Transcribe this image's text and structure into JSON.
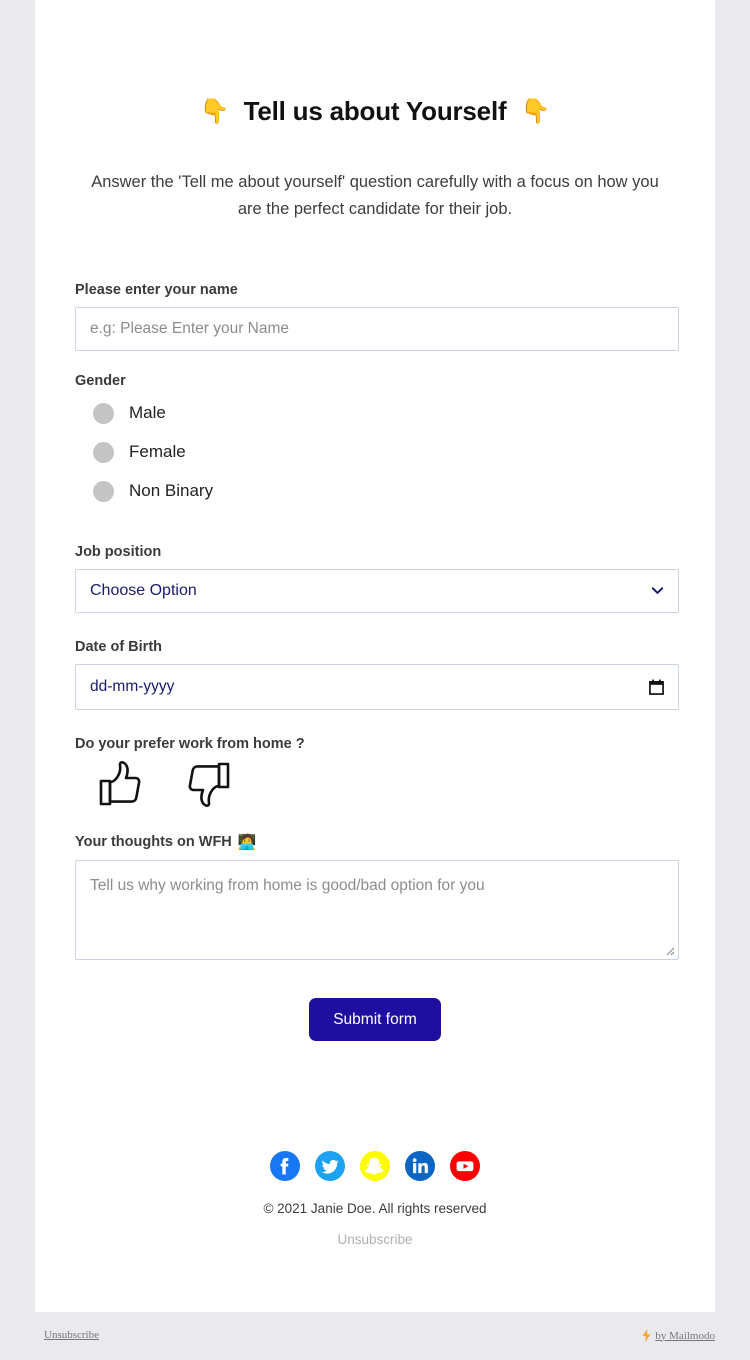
{
  "hero": {
    "emoji_left": "👇",
    "emoji_right": "👇",
    "title": "Tell us about Yourself",
    "subtitle": "Answer the 'Tell me about yourself' question carefully with a focus on how you are the perfect candidate for their job."
  },
  "form": {
    "name": {
      "label": "Please enter your name",
      "placeholder": "e.g: Please Enter your Name",
      "value": ""
    },
    "gender": {
      "label": "Gender",
      "options": [
        "Male",
        "Female",
        "Non Binary"
      ],
      "selected": ""
    },
    "job_position": {
      "label": "Job position",
      "selected": "Choose Option"
    },
    "dob": {
      "label": "Date of Birth",
      "placeholder": "dd-mm-yyyy",
      "value": ""
    },
    "wfh": {
      "label": "Do your prefer work from home ?",
      "thumbs_up": "thumbs-up",
      "thumbs_down": "thumbs-down"
    },
    "thoughts": {
      "label": "Your thoughts on WFH",
      "label_emoji": "🧑‍💻",
      "placeholder": "Tell us why working  from home is good/bad option for you",
      "value": ""
    },
    "submit_label": "Submit form"
  },
  "card_footer": {
    "socials": [
      {
        "name": "facebook",
        "color": "#1877F2"
      },
      {
        "name": "twitter",
        "color": "#1DA1F2"
      },
      {
        "name": "snapchat",
        "color": "#FFFC00"
      },
      {
        "name": "linkedin",
        "color": "#0A66C2"
      },
      {
        "name": "youtube",
        "color": "#FF0000"
      }
    ],
    "copyright": "© 2021 Janie Doe. All rights reserved",
    "unsubscribe": "Unsubscribe"
  },
  "bottom_bar": {
    "unsubscribe": "Unsubscribe",
    "bolt_color": "#F5A623",
    "powered_by": "by Mailmodo"
  },
  "colors": {
    "page_bg": "#eaeaee",
    "card_bg": "#ffffff",
    "accent": "#1f0fa0",
    "input_border": "#ccd3e2",
    "input_text": "#1b1b6b",
    "radio_fill": "#c4c4c4"
  }
}
